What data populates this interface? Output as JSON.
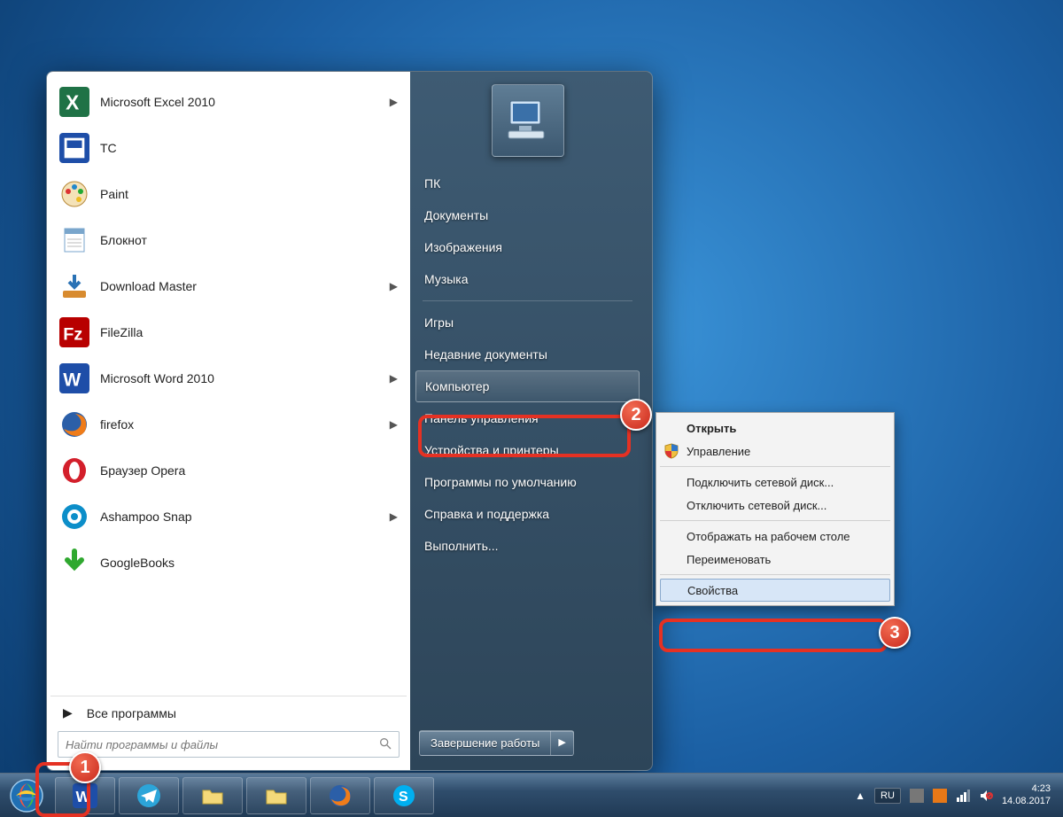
{
  "programs": [
    {
      "label": "Microsoft Excel 2010",
      "chevron": true,
      "icon": "excel"
    },
    {
      "label": "TC",
      "chevron": false,
      "icon": "tc"
    },
    {
      "label": "Paint",
      "chevron": false,
      "icon": "paint"
    },
    {
      "label": "Блокнот",
      "chevron": false,
      "icon": "notepad"
    },
    {
      "label": "Download Master",
      "chevron": true,
      "icon": "dm"
    },
    {
      "label": "FileZilla",
      "chevron": false,
      "icon": "filezilla"
    },
    {
      "label": "Microsoft Word 2010",
      "chevron": true,
      "icon": "word"
    },
    {
      "label": "firefox",
      "chevron": true,
      "icon": "firefox"
    },
    {
      "label": "Браузер Opera",
      "chevron": false,
      "icon": "opera"
    },
    {
      "label": "Ashampoo Snap",
      "chevron": true,
      "icon": "snap"
    },
    {
      "label": "GoogleBooks",
      "chevron": false,
      "icon": "gbooks"
    }
  ],
  "all_programs": "Все программы",
  "search_placeholder": "Найти программы и файлы",
  "right_links": {
    "pc": "ПК",
    "documents": "Документы",
    "pictures": "Изображения",
    "music": "Музыка",
    "games": "Игры",
    "recent": "Недавние документы",
    "computer": "Компьютер",
    "control": "Панель управления",
    "devices": "Устройства и принтеры",
    "defaults": "Программы по умолчанию",
    "help": "Справка и поддержка",
    "run": "Выполнить..."
  },
  "shutdown_label": "Завершение работы",
  "context_menu": {
    "open": "Открыть",
    "manage": "Управление",
    "map": "Подключить сетевой диск...",
    "unmap": "Отключить сетевой диск...",
    "show_desktop": "Отображать на рабочем столе",
    "rename": "Переименовать",
    "properties": "Свойства"
  },
  "taskbar": {
    "lang": "RU",
    "time": "4:23",
    "date": "14.08.2017"
  },
  "marks": {
    "one": "1",
    "two": "2",
    "three": "3"
  }
}
